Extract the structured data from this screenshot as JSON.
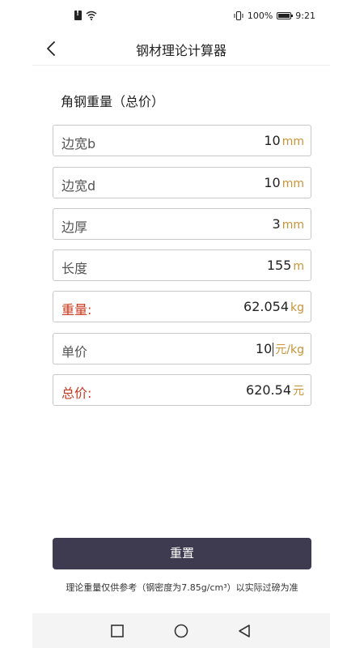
{
  "status_bar": {
    "battery_percent": "100%",
    "time": "9:21",
    "icons": [
      "sim-alert-icon",
      "wifi-icon",
      "vibrate-icon",
      "battery-icon"
    ]
  },
  "header": {
    "title": "钢材理论计算器",
    "back_icon": "chevron-left-icon"
  },
  "section": {
    "title": "角钢重量（总价）"
  },
  "fields": [
    {
      "label": "边宽b",
      "value": "10",
      "unit": "mm"
    },
    {
      "label": "边宽d",
      "value": "10",
      "unit": "mm"
    },
    {
      "label": "边厚",
      "value": "3",
      "unit": "mm"
    },
    {
      "label": "长度",
      "value": "155",
      "unit": "m"
    },
    {
      "label": "重量:",
      "value": "62.054",
      "unit": "kg"
    },
    {
      "label": "单价",
      "value": "10",
      "unit": "元/kg"
    },
    {
      "label": "总价:",
      "value": "620.54",
      "unit": "元"
    }
  ],
  "colors": {
    "result_label": "#c8381c",
    "unit": "#c89238",
    "button_bg": "#3e3a4f"
  },
  "reset_button": {
    "label": "重置"
  },
  "footnote": "理论重量仅供参考（钢密度为7.85g/cm³）以实际过磅为准",
  "nav_bar": {
    "icons": [
      "square-icon",
      "circle-icon",
      "triangle-back-icon"
    ]
  }
}
